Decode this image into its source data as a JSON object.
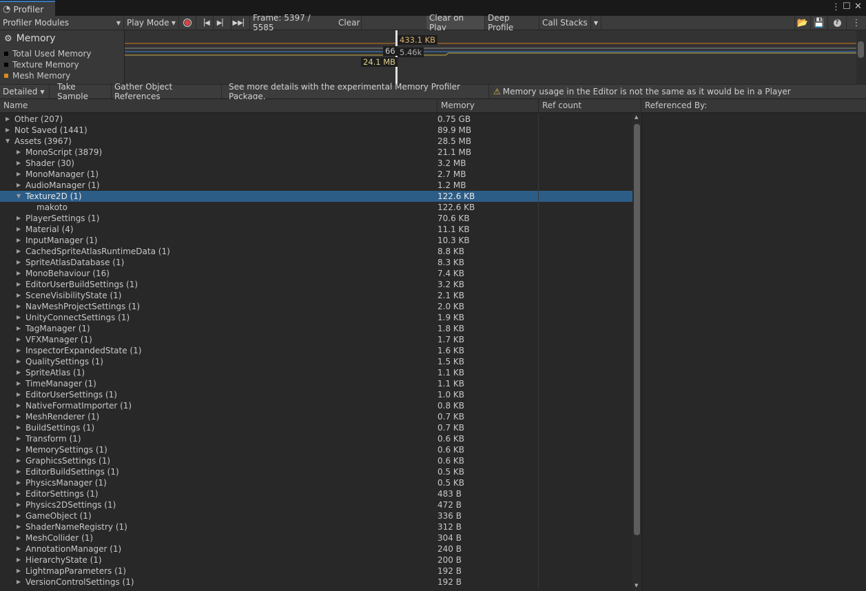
{
  "window": {
    "tab_title": "Profiler"
  },
  "toolbar": {
    "profiler_modules": "Profiler Modules",
    "play_mode": "Play Mode",
    "frame": "Frame: 5397 / 5585",
    "clear": "Clear",
    "clear_on_play": "Clear on Play",
    "deep_profile": "Deep Profile",
    "call_stacks": "Call Stacks"
  },
  "module": {
    "title": "Memory",
    "legend": [
      {
        "label": "Total Used Memory",
        "color": "#000000"
      },
      {
        "label": "Texture Memory",
        "color": "#000000"
      },
      {
        "label": "Mesh Memory",
        "color": "#d98c1f"
      }
    ]
  },
  "chart_tags": {
    "a": "433.1 KB",
    "b": "66",
    "c": "5.46k",
    "d": "24.1 MB"
  },
  "subbar": {
    "view": "Detailed",
    "take_sample": "Take Sample",
    "gather": "Gather Object References",
    "more": "See more details with the experimental Memory Profiler Package.",
    "warning": "Memory usage in the Editor is not the same as it would be in a Player"
  },
  "columns": {
    "name": "Name",
    "memory": "Memory",
    "refcount": "Ref count",
    "referenced_by": "Referenced By:"
  },
  "rows": [
    {
      "name": "Other (207)",
      "mem": "0.75 GB",
      "level": 0,
      "state": "closed"
    },
    {
      "name": "Not Saved (1441)",
      "mem": "89.9 MB",
      "level": 0,
      "state": "closed"
    },
    {
      "name": "Assets (3967)",
      "mem": "28.5 MB",
      "level": 0,
      "state": "open"
    },
    {
      "name": "MonoScript (3879)",
      "mem": "21.1 MB",
      "level": 1,
      "state": "closed"
    },
    {
      "name": "Shader (30)",
      "mem": "3.2 MB",
      "level": 1,
      "state": "closed"
    },
    {
      "name": "MonoManager (1)",
      "mem": "2.7 MB",
      "level": 1,
      "state": "closed"
    },
    {
      "name": "AudioManager (1)",
      "mem": "1.2 MB",
      "level": 1,
      "state": "closed"
    },
    {
      "name": "Texture2D (1)",
      "mem": "122.6 KB",
      "level": 1,
      "state": "open",
      "selected": true
    },
    {
      "name": "makoto",
      "mem": "122.6 KB",
      "level": 2,
      "state": "leaf"
    },
    {
      "name": "PlayerSettings (1)",
      "mem": "70.6 KB",
      "level": 1,
      "state": "closed"
    },
    {
      "name": "Material (4)",
      "mem": "11.1 KB",
      "level": 1,
      "state": "closed"
    },
    {
      "name": "InputManager (1)",
      "mem": "10.3 KB",
      "level": 1,
      "state": "closed"
    },
    {
      "name": "CachedSpriteAtlasRuntimeData (1)",
      "mem": "8.8 KB",
      "level": 1,
      "state": "closed"
    },
    {
      "name": "SpriteAtlasDatabase (1)",
      "mem": "8.3 KB",
      "level": 1,
      "state": "closed"
    },
    {
      "name": "MonoBehaviour (16)",
      "mem": "7.4 KB",
      "level": 1,
      "state": "closed"
    },
    {
      "name": "EditorUserBuildSettings (1)",
      "mem": "3.2 KB",
      "level": 1,
      "state": "closed"
    },
    {
      "name": "SceneVisibilityState (1)",
      "mem": "2.1 KB",
      "level": 1,
      "state": "closed"
    },
    {
      "name": "NavMeshProjectSettings (1)",
      "mem": "2.0 KB",
      "level": 1,
      "state": "closed"
    },
    {
      "name": "UnityConnectSettings (1)",
      "mem": "1.9 KB",
      "level": 1,
      "state": "closed"
    },
    {
      "name": "TagManager (1)",
      "mem": "1.8 KB",
      "level": 1,
      "state": "closed"
    },
    {
      "name": "VFXManager (1)",
      "mem": "1.7 KB",
      "level": 1,
      "state": "closed"
    },
    {
      "name": "InspectorExpandedState (1)",
      "mem": "1.6 KB",
      "level": 1,
      "state": "closed"
    },
    {
      "name": "QualitySettings (1)",
      "mem": "1.5 KB",
      "level": 1,
      "state": "closed"
    },
    {
      "name": "SpriteAtlas (1)",
      "mem": "1.1 KB",
      "level": 1,
      "state": "closed"
    },
    {
      "name": "TimeManager (1)",
      "mem": "1.1 KB",
      "level": 1,
      "state": "closed"
    },
    {
      "name": "EditorUserSettings (1)",
      "mem": "1.0 KB",
      "level": 1,
      "state": "closed"
    },
    {
      "name": "NativeFormatImporter (1)",
      "mem": "0.8 KB",
      "level": 1,
      "state": "closed"
    },
    {
      "name": "MeshRenderer (1)",
      "mem": "0.7 KB",
      "level": 1,
      "state": "closed"
    },
    {
      "name": "BuildSettings (1)",
      "mem": "0.7 KB",
      "level": 1,
      "state": "closed"
    },
    {
      "name": "Transform (1)",
      "mem": "0.6 KB",
      "level": 1,
      "state": "closed"
    },
    {
      "name": "MemorySettings (1)",
      "mem": "0.6 KB",
      "level": 1,
      "state": "closed"
    },
    {
      "name": "GraphicsSettings (1)",
      "mem": "0.6 KB",
      "level": 1,
      "state": "closed"
    },
    {
      "name": "EditorBuildSettings (1)",
      "mem": "0.5 KB",
      "level": 1,
      "state": "closed"
    },
    {
      "name": "PhysicsManager (1)",
      "mem": "0.5 KB",
      "level": 1,
      "state": "closed"
    },
    {
      "name": "EditorSettings (1)",
      "mem": "483 B",
      "level": 1,
      "state": "closed"
    },
    {
      "name": "Physics2DSettings (1)",
      "mem": "472 B",
      "level": 1,
      "state": "closed"
    },
    {
      "name": "GameObject (1)",
      "mem": "336 B",
      "level": 1,
      "state": "closed"
    },
    {
      "name": "ShaderNameRegistry (1)",
      "mem": "312 B",
      "level": 1,
      "state": "closed"
    },
    {
      "name": "MeshCollider (1)",
      "mem": "304 B",
      "level": 1,
      "state": "closed"
    },
    {
      "name": "AnnotationManager (1)",
      "mem": "240 B",
      "level": 1,
      "state": "closed"
    },
    {
      "name": "HierarchyState (1)",
      "mem": "200 B",
      "level": 1,
      "state": "closed"
    },
    {
      "name": "LightmapParameters (1)",
      "mem": "192 B",
      "level": 1,
      "state": "closed"
    },
    {
      "name": "VersionControlSettings (1)",
      "mem": "192 B",
      "level": 1,
      "state": "closed"
    }
  ]
}
